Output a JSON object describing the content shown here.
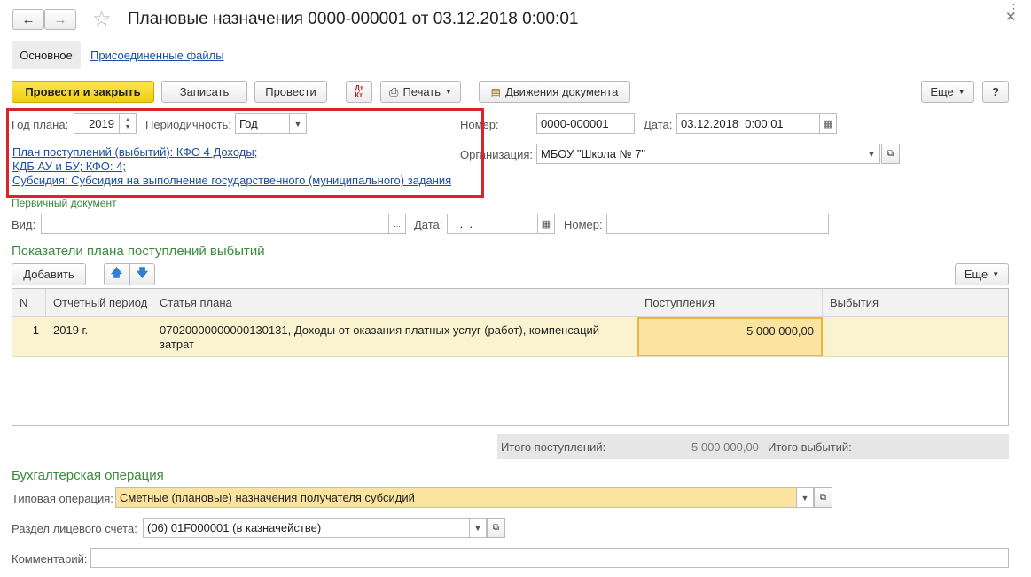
{
  "window": {
    "title": "Плановые назначения 0000-000001 от 03.12.2018 0:00:01"
  },
  "tabs": {
    "main": "Основное",
    "files": "Присоединенные файлы"
  },
  "toolbar": {
    "post_close": "Провести и закрыть",
    "save": "Записать",
    "post": "Провести",
    "print": "Печать",
    "movements": "Движения документа",
    "more": "Еще",
    "help": "?"
  },
  "header": {
    "year_label": "Год плана:",
    "year_value": "2019",
    "period_label": "Периодичность:",
    "period_value": "Год",
    "number_label": "Номер:",
    "number_value": "0000-000001",
    "date_label": "Дата:",
    "date_value": "03.12.2018  0:00:01",
    "org_label": "Организация:",
    "org_value": "МБОУ \"Школа № 7\"",
    "plan_link_1": "План поступлений (выбытий): КФО 4 Доходы;",
    "plan_link_2": "КДБ АУ и БУ; КФО: 4;",
    "plan_link_3": "Субсидия: Субсидия на выполнение государственного (муниципального) задания"
  },
  "primary_doc": {
    "title": "Первичный документ",
    "kind_label": "Вид:",
    "kind_value": "",
    "date_label": "Дата:",
    "date_value": " .  .",
    "number_label": "Номер:",
    "number_value": ""
  },
  "indicators": {
    "title": "Показатели плана поступлений выбытий",
    "add": "Добавить",
    "more": "Еще",
    "columns": [
      "N",
      "Отчетный период",
      "Статья плана",
      "Поступления",
      "Выбытия"
    ],
    "rows": [
      {
        "n": "1",
        "period": "2019 г.",
        "article": "07020000000000130131, Доходы от оказания платных услуг (работ), компенсаций затрат",
        "income": "5 000 000,00",
        "expense": ""
      }
    ]
  },
  "totals": {
    "income_label": "Итого поступлений:",
    "income_value": "5 000 000,00",
    "expense_label": "Итого выбытий:",
    "expense_value": ""
  },
  "accounting": {
    "title": "Бухгалтерская операция",
    "operation_label": "Типовая операция:",
    "operation_value": "Сметные (плановые) назначения получателя субсидий",
    "section_label": "Раздел лицевого счета:",
    "section_value": "(06) 01F000001 (в казначействе)",
    "comment_label": "Комментарий:",
    "comment_value": ""
  },
  "icons": {
    "back": "arrow-left-icon",
    "forward": "arrow-right-icon",
    "favorite": "star-icon",
    "more_window": "more-dots-icon",
    "close": "close-icon"
  },
  "colors": {
    "highlight_frame": "#d9232d",
    "primary_button": "#f5d81e",
    "selected_row": "#fbf3cf",
    "selected_cell": "#fbe3a0",
    "section_title": "#3b8a3b"
  }
}
